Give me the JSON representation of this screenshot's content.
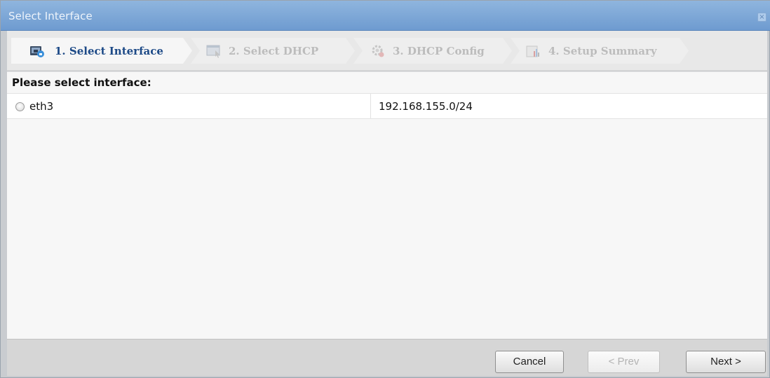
{
  "window": {
    "title": "Select Interface",
    "close_glyph": "×"
  },
  "steps": [
    {
      "label": "1. Select Interface",
      "icon": "interface-icon",
      "state": "active"
    },
    {
      "label": "2. Select DHCP",
      "icon": "dhcp-select-icon",
      "state": "inactive"
    },
    {
      "label": "3. DHCP Config",
      "icon": "config-gear-icon",
      "state": "inactive"
    },
    {
      "label": "4. Setup Summary",
      "icon": "summary-chart-icon",
      "state": "inactive"
    }
  ],
  "content": {
    "prompt": "Please select interface:",
    "interfaces": [
      {
        "name": "eth3",
        "subnet": "192.168.155.0/24",
        "selected": false
      }
    ]
  },
  "footer": {
    "cancel_label": "Cancel",
    "prev_label": "< Prev",
    "next_label": "Next >"
  },
  "colors": {
    "titlebar": "#7aa6d8",
    "active_step_text": "#1d4a87",
    "inactive_step_text": "#bcbcbc"
  }
}
